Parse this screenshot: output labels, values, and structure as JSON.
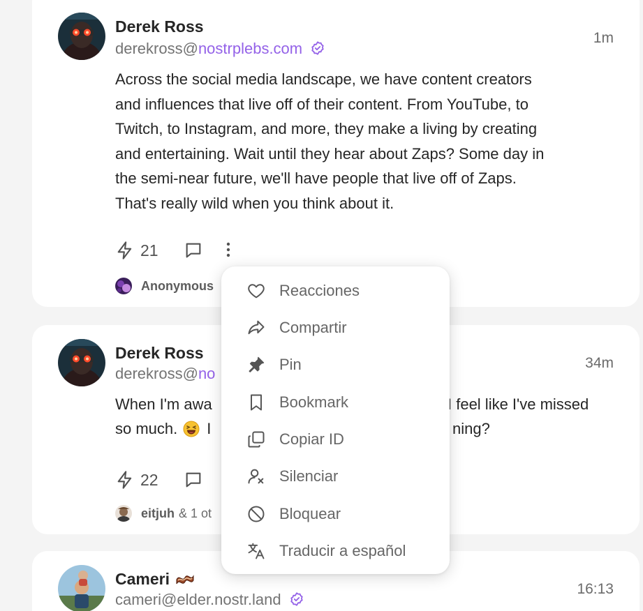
{
  "posts": [
    {
      "author": "Derek Ross",
      "handle_user": "derekross@",
      "handle_domain": "nostrplebs.com",
      "time": "1m",
      "lines": [
        "Across the social media landscape, we have content creators",
        "and influences that live off of their content. From YouTube, to",
        "Twitch, to Instagram, and more, they make a living by creating",
        "and entertaining. Wait until they hear about Zaps? Some day in",
        "the semi-near future, we'll have people that live off of Zaps.",
        "That's really wild when you think about it."
      ],
      "zap_count": "21",
      "zapper": "Anonymous"
    },
    {
      "author": "Derek Ross",
      "handle_user": "derekross@",
      "handle_domain": "no",
      "time": "34m",
      "line1_left": "When I'm awa",
      "line1_right": "I feel like I've missed",
      "line2_left": "so much.",
      "line2_mid": "I",
      "line2_right": "ning?",
      "zap_count": "22",
      "zapper": "eitjuh",
      "zapper_suffix": "& 1 ot"
    },
    {
      "author": "Cameri",
      "handle_user": "cameri@",
      "handle_domain": "elder.nostr.land",
      "time": "16:13"
    }
  ],
  "menu": {
    "items": [
      {
        "label": "Reacciones",
        "icon": "heart-icon"
      },
      {
        "label": "Compartir",
        "icon": "share-icon"
      },
      {
        "label": "Pin",
        "icon": "pin-icon"
      },
      {
        "label": "Bookmark",
        "icon": "bookmark-icon"
      },
      {
        "label": "Copiar ID",
        "icon": "copy-icon"
      },
      {
        "label": "Silenciar",
        "icon": "mute-user-icon"
      },
      {
        "label": "Bloquear",
        "icon": "block-icon"
      },
      {
        "label": "Traducir a español",
        "icon": "translate-icon"
      }
    ]
  },
  "colors": {
    "accent": "#9462e8",
    "text": "#262626",
    "muted": "#737373",
    "background": "#f4f4f4",
    "card": "#ffffff"
  }
}
